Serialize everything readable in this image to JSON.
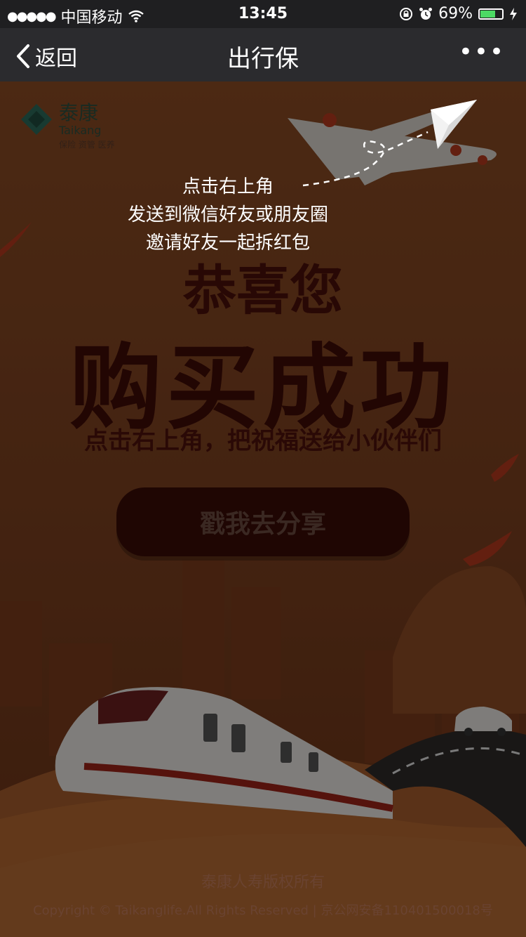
{
  "status_bar": {
    "carrier": "中国移动",
    "time": "13:45",
    "battery_percent": "69%",
    "battery_level": 0.69,
    "signal_icon": "signal-dots-icon",
    "wifi_icon": "wifi-icon",
    "lock_icon": "rotation-lock-icon",
    "alarm_icon": "alarm-icon",
    "charging_icon": "charging-bolt-icon"
  },
  "nav": {
    "back_label": "返回",
    "title": "出行保",
    "more_icon": "more-dots-icon"
  },
  "logo": {
    "name": "泰康",
    "subname": "Taikang",
    "tagline": "保险 资管 医养"
  },
  "hint": {
    "line1": "点击右上角",
    "line2": "发送到微信好友或朋友圈",
    "line3": "邀请好友一起拆红包"
  },
  "main": {
    "headline1": "恭喜您",
    "headline2": "购买成功",
    "subline": "点击右上角，把祝福送给小伙伴们",
    "share_button": "戳我去分享"
  },
  "footer": {
    "copyright_cn": "泰康人寿版权所有",
    "copyright_en": "Copyright © Taikanglife.All Rights Reserved | 京公网安备110401500018号"
  },
  "colors": {
    "background": "#8a4b24",
    "headline": "#3f0b07",
    "button": "#3a0c07",
    "navbar": "#2b2b2e"
  }
}
